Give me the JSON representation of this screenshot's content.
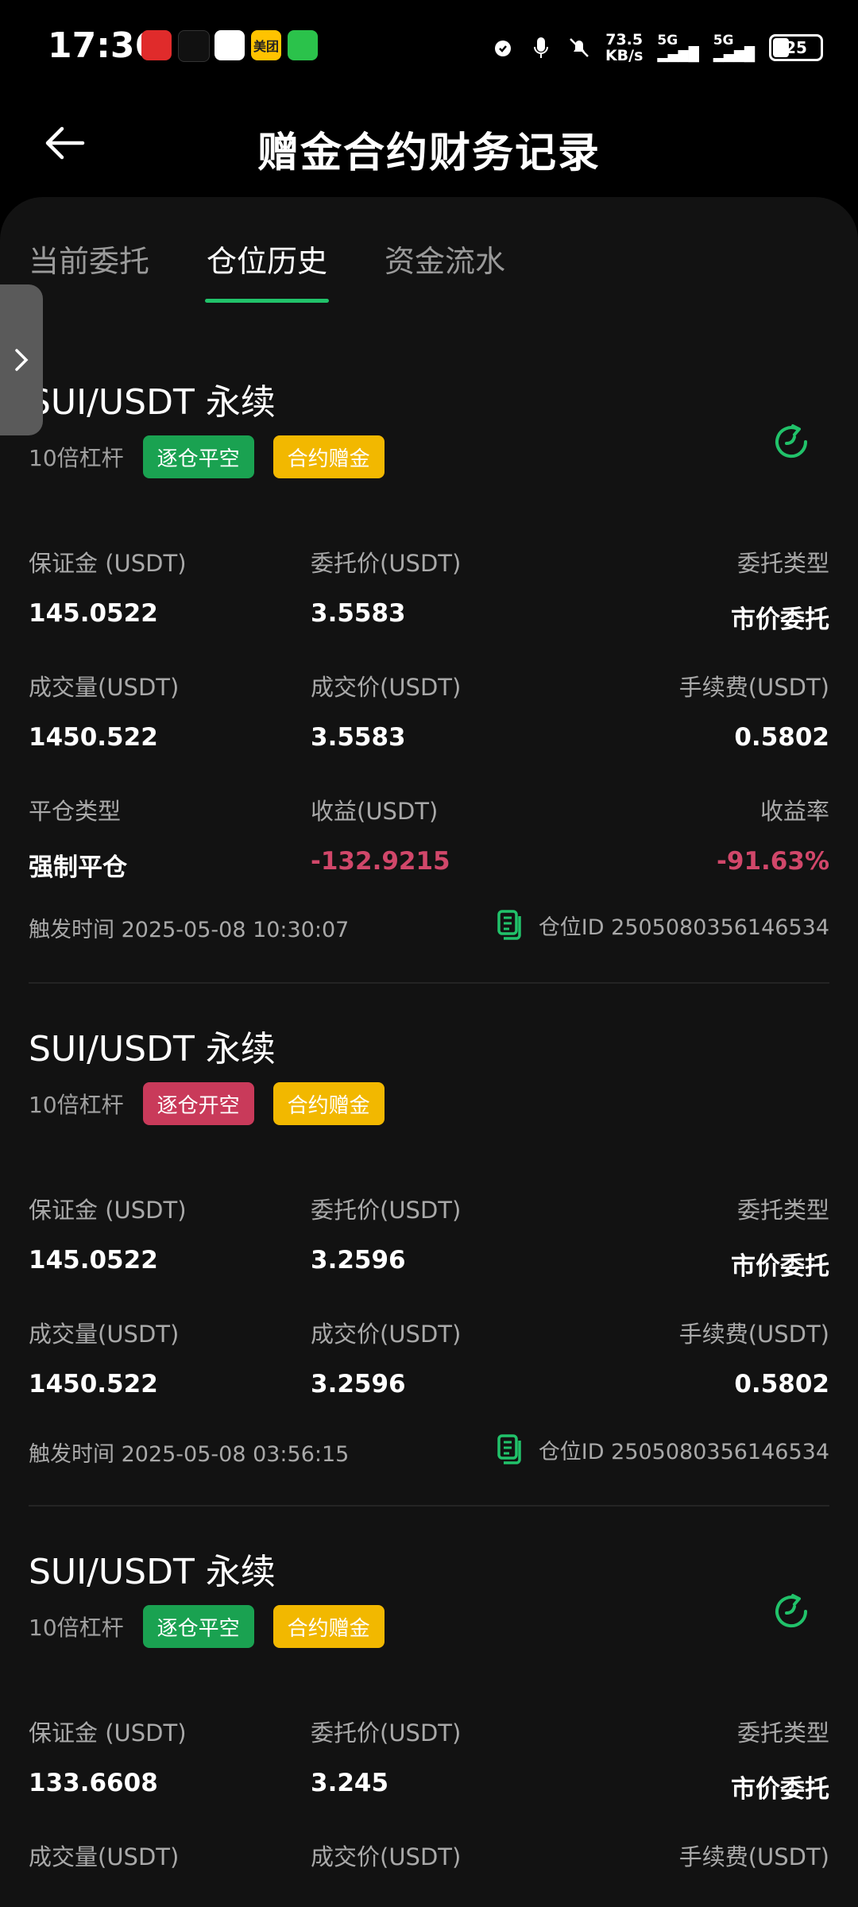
{
  "status": {
    "time": "17:36",
    "net_speed": "73.5",
    "net_unit": "KB/s",
    "sig1": "5G",
    "sig2": "5G",
    "battery": "25",
    "app_badge": "美团"
  },
  "header": {
    "title": "赠金合约财务记录"
  },
  "tabs": [
    "当前委托",
    "仓位历史",
    "资金流水"
  ],
  "colors": {
    "green": "#1aa251",
    "red": "#c93a5a",
    "yellow": "#f2b800",
    "accent": "#21c26a",
    "loss": "#d1476a"
  },
  "records": [
    {
      "title": "SUI/USDT 永续",
      "leverage": "10倍杠杆",
      "side": "逐仓平空",
      "tag": "合约赠金",
      "margin_label": "保证金 (USDT)",
      "margin": "145.0522",
      "order_price_label": "委托价(USDT)",
      "order_price": "3.5583",
      "order_type_label": "委托类型",
      "order_type": "市价委托",
      "volume_label": "成交量(USDT)",
      "volume": "1450.522",
      "deal_price_label": "成交价(USDT)",
      "deal_price": "3.5583",
      "fee_label": "手续费(USDT)",
      "fee": "0.5802",
      "close_type_label": "平仓类型",
      "close_type": "强制平仓",
      "pnl_label": "收益(USDT)",
      "pnl": "-132.9215",
      "roi_label": "收益率",
      "roi": "-91.63%",
      "time": "触发时间 2025-05-08 10:30:07",
      "position_id": "仓位ID 2505080356146534"
    },
    {
      "title": "SUI/USDT 永续",
      "leverage": "10倍杠杆",
      "side": "逐仓开空",
      "tag": "合约赠金",
      "margin_label": "保证金 (USDT)",
      "margin": "145.0522",
      "order_price_label": "委托价(USDT)",
      "order_price": "3.2596",
      "order_type_label": "委托类型",
      "order_type": "市价委托",
      "volume_label": "成交量(USDT)",
      "volume": "1450.522",
      "deal_price_label": "成交价(USDT)",
      "deal_price": "3.2596",
      "fee_label": "手续费(USDT)",
      "fee": "0.5802",
      "time": "触发时间 2025-05-08 03:56:15",
      "position_id": "仓位ID 2505080356146534"
    },
    {
      "title": "SUI/USDT 永续",
      "leverage": "10倍杠杆",
      "side": "逐仓平空",
      "tag": "合约赠金",
      "margin_label": "保证金 (USDT)",
      "margin": "133.6608",
      "order_price_label": "委托价(USDT)",
      "order_price": "3.245",
      "order_type_label": "委托类型",
      "order_type": "市价委托",
      "volume_label": "成交量(USDT)",
      "deal_price_label": "成交价(USDT)",
      "fee_label": "手续费(USDT)"
    }
  ]
}
